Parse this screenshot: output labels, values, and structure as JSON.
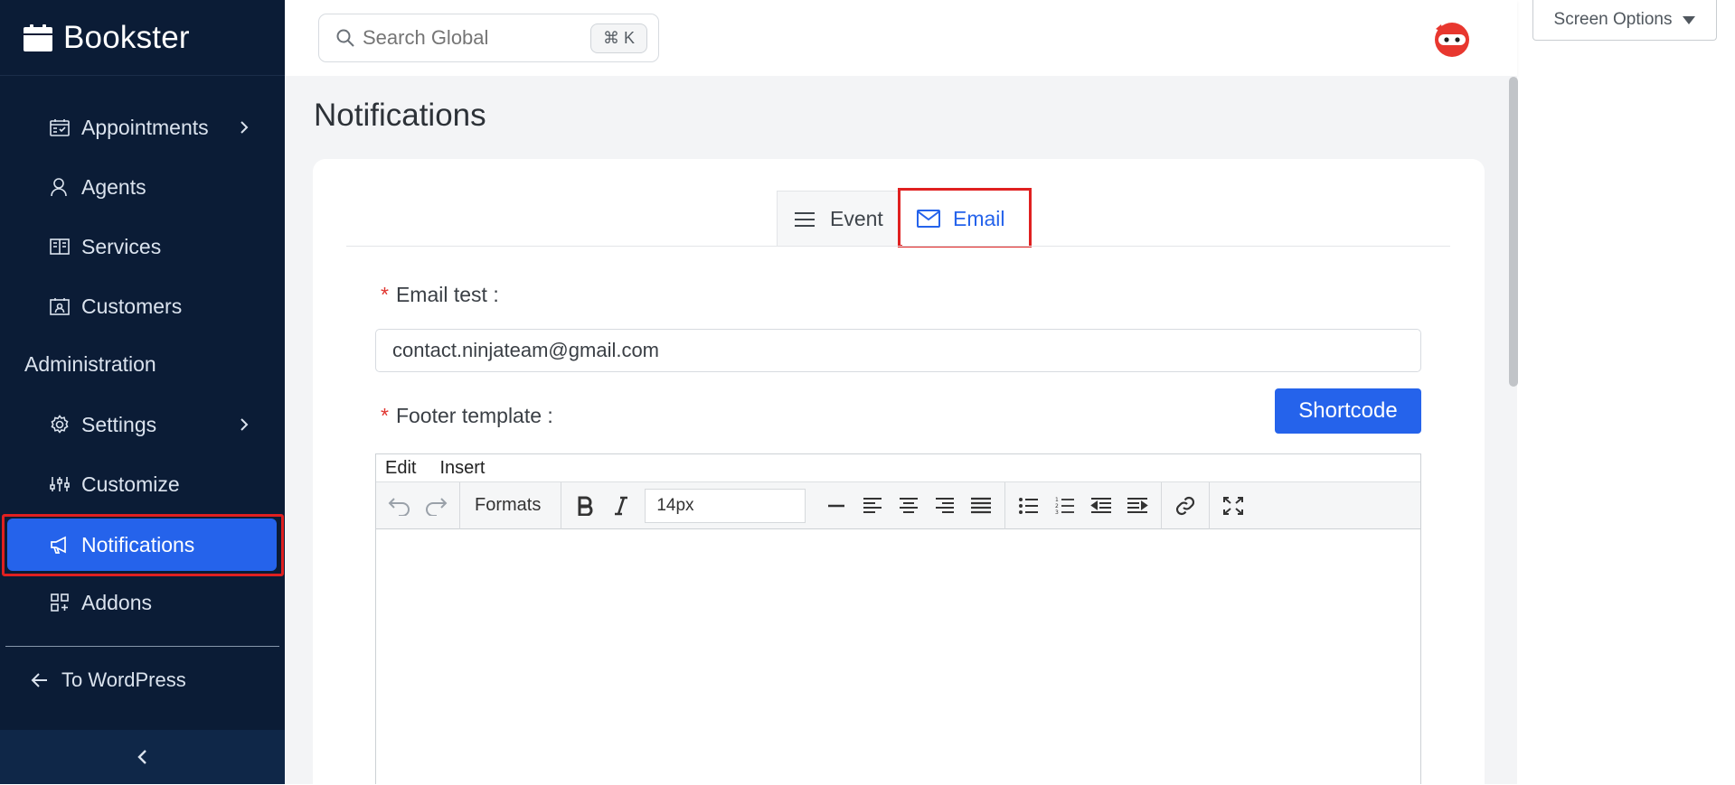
{
  "app": {
    "name": "Bookster"
  },
  "sidebar": {
    "items": [
      {
        "label": "Appointments",
        "icon": "calendar-check-icon",
        "has_submenu": true
      },
      {
        "label": "Agents",
        "icon": "user-icon",
        "has_submenu": false
      },
      {
        "label": "Services",
        "icon": "book-open-icon",
        "has_submenu": false
      },
      {
        "label": "Customers",
        "icon": "contact-card-icon",
        "has_submenu": false
      }
    ],
    "section_label": "Administration",
    "admin_items": [
      {
        "label": "Settings",
        "icon": "gear-icon",
        "has_submenu": true
      },
      {
        "label": "Customize",
        "icon": "sliders-icon",
        "has_submenu": false
      },
      {
        "label": "Notifications",
        "icon": "megaphone-icon",
        "active": true
      },
      {
        "label": "Addons",
        "icon": "grid-icon",
        "has_submenu": false
      }
    ],
    "to_wordpress": "To WordPress"
  },
  "header": {
    "search_placeholder": "Search Global",
    "search_shortcut": "⌘ K"
  },
  "screen_options": {
    "label": "Screen Options"
  },
  "page": {
    "title": "Notifications",
    "tabs": [
      {
        "label": "Event",
        "icon": "list-icon",
        "active": false
      },
      {
        "label": "Email",
        "icon": "mail-icon",
        "active": true
      }
    ],
    "form": {
      "email_test_label": "Email test :",
      "email_test_value": "contact.ninjateam@gmail.com",
      "footer_template_label": "Footer template :",
      "shortcode_button": "Shortcode"
    },
    "editor": {
      "menu": [
        "Edit",
        "Insert"
      ],
      "formats_label": "Formats",
      "font_size": "14px"
    }
  },
  "colors": {
    "sidebar_bg": "#0b1c36",
    "accent": "#2563eb",
    "highlight": "#e02020"
  }
}
